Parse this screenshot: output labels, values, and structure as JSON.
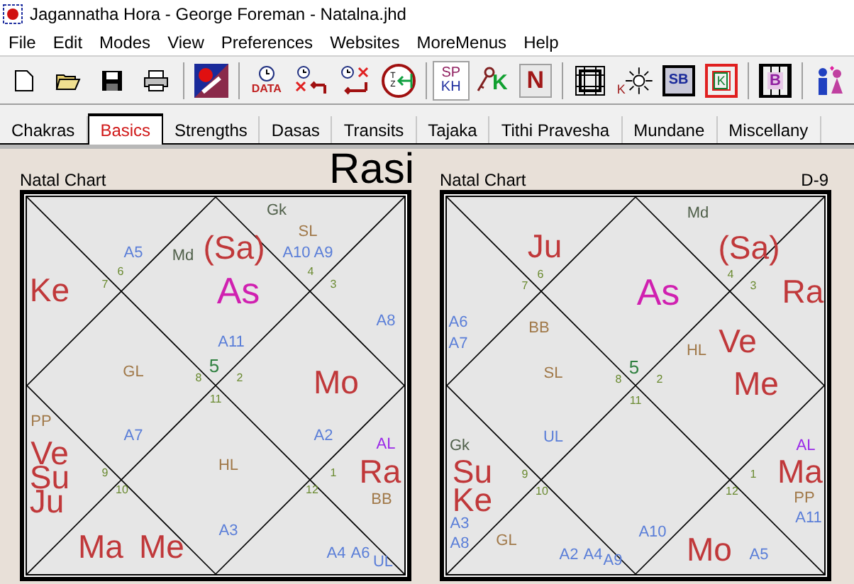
{
  "window": {
    "title": "Jagannatha Hora - George Foreman - Natalna.jhd"
  },
  "menu": [
    "File",
    "Edit",
    "Modes",
    "View",
    "Preferences",
    "Websites",
    "MoreMenus",
    "Help"
  ],
  "toolbar": [
    [
      {
        "kind": "new"
      },
      {
        "kind": "open"
      },
      {
        "kind": "save"
      },
      {
        "kind": "print"
      }
    ],
    [
      {
        "kind": "logo"
      }
    ],
    [
      {
        "kind": "clock-data",
        "label": "DATA"
      },
      {
        "kind": "clock-back"
      },
      {
        "kind": "clock-x"
      },
      {
        "kind": "tz",
        "label": "TZ"
      }
    ],
    [
      {
        "kind": "sp-kh",
        "label": "SP",
        "label2": "KH"
      },
      {
        "kind": "key",
        "label": "K"
      },
      {
        "kind": "letter-box",
        "label": "N"
      }
    ],
    [
      {
        "kind": "grid"
      },
      {
        "kind": "sun",
        "label": "K"
      },
      {
        "kind": "sb",
        "label": "SB"
      },
      {
        "kind": "k-box",
        "label": "K"
      }
    ],
    [
      {
        "kind": "b-grid",
        "label": "B"
      }
    ],
    [
      {
        "kind": "couple"
      }
    ]
  ],
  "tabs": [
    {
      "label": "Chakras",
      "selected": false
    },
    {
      "label": "Basics",
      "selected": true
    },
    {
      "label": "Strengths",
      "selected": false
    },
    {
      "label": "Dasas",
      "selected": false
    },
    {
      "label": "Transits",
      "selected": false
    },
    {
      "label": "Tajaka",
      "selected": false
    },
    {
      "label": "Tithi Pravesha",
      "selected": false
    },
    {
      "label": "Mundane",
      "selected": false
    },
    {
      "label": "Miscellany",
      "selected": false
    }
  ],
  "charts": [
    {
      "title": "Natal Chart",
      "name": "Rasi",
      "kind": "rasi",
      "labels": [
        {
          "text": "Gk",
          "kind": "upagraha"
        },
        {
          "text": "SL",
          "kind": "special"
        },
        {
          "text": "A5",
          "kind": "arudha"
        },
        {
          "text": "Md",
          "kind": "upagraha"
        },
        {
          "text": "(Sa)",
          "kind": "planet"
        },
        {
          "text": "A10",
          "kind": "arudha"
        },
        {
          "text": "A9",
          "kind": "arudha"
        },
        {
          "text": "6",
          "kind": "sign"
        },
        {
          "text": "4",
          "kind": "sign"
        },
        {
          "text": "Ke",
          "kind": "planet"
        },
        {
          "text": "7",
          "kind": "sign"
        },
        {
          "text": "As",
          "kind": "lagna"
        },
        {
          "text": "3",
          "kind": "sign"
        },
        {
          "text": "A8",
          "kind": "arudha"
        },
        {
          "text": "A11",
          "kind": "arudha"
        },
        {
          "text": "GL",
          "kind": "special"
        },
        {
          "text": "5",
          "kind": "sign-main"
        },
        {
          "text": "8",
          "kind": "sign"
        },
        {
          "text": "2",
          "kind": "sign"
        },
        {
          "text": "Mo",
          "kind": "planet"
        },
        {
          "text": "11",
          "kind": "sign"
        },
        {
          "text": "PP",
          "kind": "special"
        },
        {
          "text": "A7",
          "kind": "arudha"
        },
        {
          "text": "A2",
          "kind": "arudha"
        },
        {
          "text": "AL",
          "kind": "arudha-lagna"
        },
        {
          "text": "Ve",
          "kind": "planet"
        },
        {
          "text": "Su",
          "kind": "planet"
        },
        {
          "text": "9",
          "kind": "sign"
        },
        {
          "text": "HL",
          "kind": "special"
        },
        {
          "text": "1",
          "kind": "sign"
        },
        {
          "text": "Ra",
          "kind": "planet"
        },
        {
          "text": "Ju",
          "kind": "planet"
        },
        {
          "text": "10",
          "kind": "sign"
        },
        {
          "text": "12",
          "kind": "sign"
        },
        {
          "text": "BB",
          "kind": "special"
        },
        {
          "text": "A3",
          "kind": "arudha"
        },
        {
          "text": "Ma",
          "kind": "planet"
        },
        {
          "text": "Me",
          "kind": "planet"
        },
        {
          "text": "A4",
          "kind": "arudha"
        },
        {
          "text": "A6",
          "kind": "arudha"
        },
        {
          "text": "UL",
          "kind": "arudha"
        }
      ]
    },
    {
      "title": "Natal Chart",
      "name": "D-9",
      "kind": "divisional",
      "labels": [
        {
          "text": "Md",
          "kind": "upagraha"
        },
        {
          "text": "Ju",
          "kind": "planet"
        },
        {
          "text": "(Sa)",
          "kind": "planet"
        },
        {
          "text": "6",
          "kind": "sign"
        },
        {
          "text": "4",
          "kind": "sign"
        },
        {
          "text": "7",
          "kind": "sign"
        },
        {
          "text": "As",
          "kind": "lagna"
        },
        {
          "text": "3",
          "kind": "sign"
        },
        {
          "text": "Ra",
          "kind": "planet"
        },
        {
          "text": "A6",
          "kind": "arudha"
        },
        {
          "text": "BB",
          "kind": "special"
        },
        {
          "text": "A7",
          "kind": "arudha"
        },
        {
          "text": "HL",
          "kind": "special"
        },
        {
          "text": "Ve",
          "kind": "planet"
        },
        {
          "text": "SL",
          "kind": "special"
        },
        {
          "text": "5",
          "kind": "sign-main"
        },
        {
          "text": "8",
          "kind": "sign"
        },
        {
          "text": "2",
          "kind": "sign"
        },
        {
          "text": "Me",
          "kind": "planet"
        },
        {
          "text": "11",
          "kind": "sign"
        },
        {
          "text": "Gk",
          "kind": "upagraha"
        },
        {
          "text": "UL",
          "kind": "arudha"
        },
        {
          "text": "AL",
          "kind": "arudha-lagna"
        },
        {
          "text": "Su",
          "kind": "planet"
        },
        {
          "text": "9",
          "kind": "sign"
        },
        {
          "text": "1",
          "kind": "sign"
        },
        {
          "text": "Ma",
          "kind": "planet"
        },
        {
          "text": "Ke",
          "kind": "planet"
        },
        {
          "text": "10",
          "kind": "sign"
        },
        {
          "text": "12",
          "kind": "sign"
        },
        {
          "text": "PP",
          "kind": "special"
        },
        {
          "text": "A3",
          "kind": "arudha"
        },
        {
          "text": "A11",
          "kind": "arudha"
        },
        {
          "text": "A8",
          "kind": "arudha"
        },
        {
          "text": "GL",
          "kind": "special"
        },
        {
          "text": "A10",
          "kind": "arudha"
        },
        {
          "text": "A2",
          "kind": "arudha"
        },
        {
          "text": "A4",
          "kind": "arudha"
        },
        {
          "text": "A9",
          "kind": "arudha"
        },
        {
          "text": "Mo",
          "kind": "planet"
        },
        {
          "text": "A5",
          "kind": "arudha"
        }
      ]
    }
  ]
}
